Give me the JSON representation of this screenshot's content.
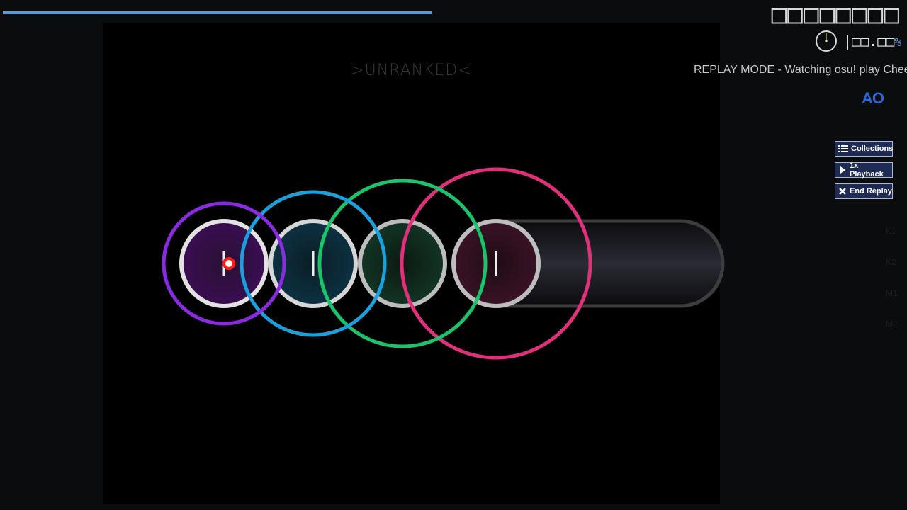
{
  "hud": {
    "score": "□□□□□□□□",
    "accuracy": "|□□.□□",
    "accuracy_percent_sign": "%",
    "song_progress": 0.48,
    "unranked_label": ">UNRANKED<",
    "replay_banner": "REPLAY MODE - Watching osu! play Chee",
    "mod_badge": "AO"
  },
  "buttons": {
    "collections": "Collections",
    "playback": "1x Playback",
    "end_replay": "End Replay"
  },
  "key_overlay": [
    "K1",
    "K2",
    "M1",
    "M2"
  ],
  "colors": {
    "progress": "#5b9bd8",
    "hit_circles": [
      "#8a2be2",
      "#1aa0dc",
      "#19c46a",
      "#e0307a"
    ],
    "cursor": "#ff1a1a",
    "mod_badge": "#2a66d6",
    "button_bg": "#1d2b55"
  },
  "icons": {
    "collections": "list-icon",
    "playback": "play-icon",
    "end_replay": "close-icon",
    "accuracy": "clock-pie-icon"
  }
}
